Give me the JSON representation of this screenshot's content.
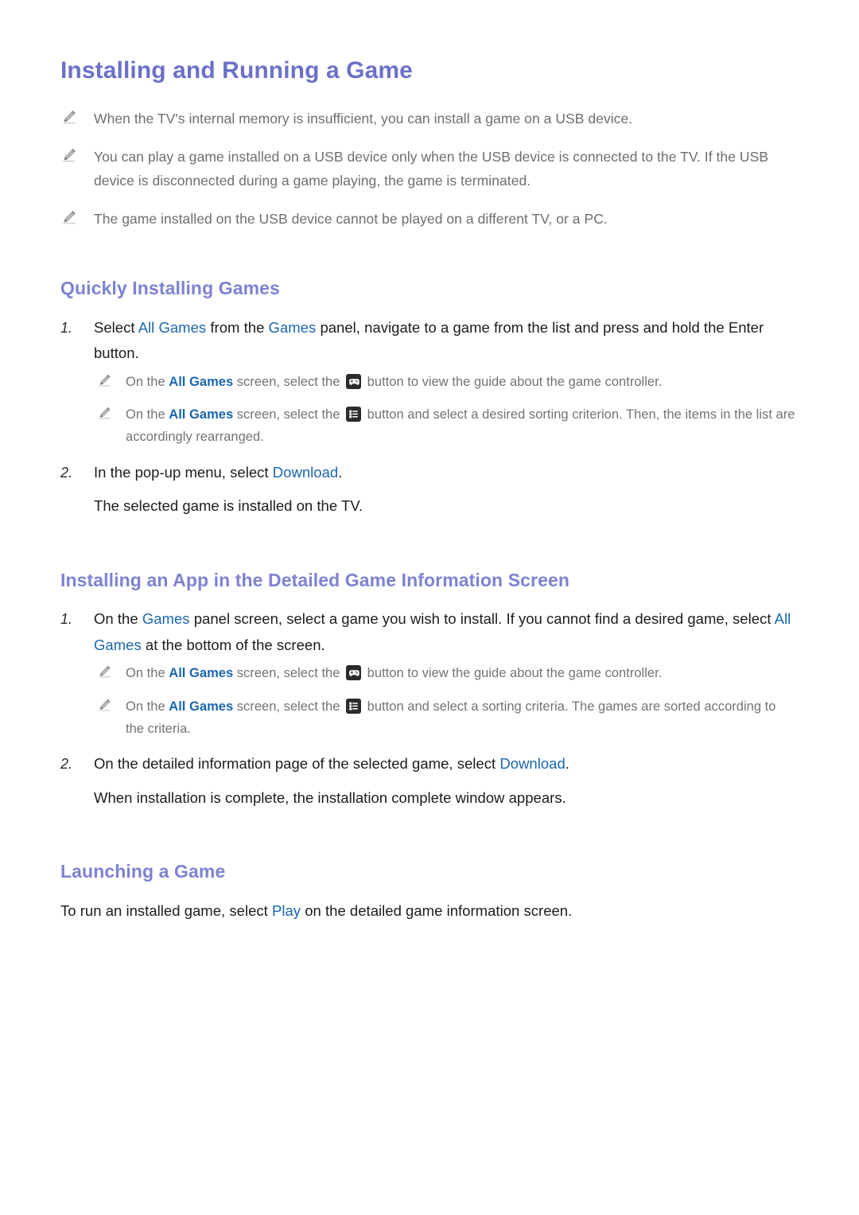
{
  "document": {
    "title": "Installing and Running a Game",
    "intro_notes": [
      "When the TV's internal memory is insufficient, you can install a game on a USB device.",
      "You can play a game installed on a USB device only when the USB device is connected to the TV. If the USB device is disconnected during a game playing, the game is terminated.",
      "The game installed on the USB device cannot be played on a different TV, or a PC."
    ],
    "sections": [
      {
        "heading": "Quickly Installing Games",
        "steps": [
          {
            "number": "1.",
            "parts": [
              {
                "text": "Select ",
                "style": "plain"
              },
              {
                "text": "All Games",
                "style": "link"
              },
              {
                "text": " from the ",
                "style": "plain"
              },
              {
                "text": "Games",
                "style": "link"
              },
              {
                "text": " panel, navigate to a game from the list and press and hold the Enter button.",
                "style": "plain"
              }
            ],
            "subnotes": [
              {
                "parts": [
                  {
                    "text": "On the ",
                    "style": "plain"
                  },
                  {
                    "text": "All Games",
                    "style": "link-bold"
                  },
                  {
                    "text": " screen, select the ",
                    "style": "plain"
                  },
                  {
                    "icon": "gamepad-icon"
                  },
                  {
                    "text": " button to view the guide about the game controller.",
                    "style": "plain"
                  }
                ]
              },
              {
                "parts": [
                  {
                    "text": "On the ",
                    "style": "plain"
                  },
                  {
                    "text": "All Games",
                    "style": "link-bold"
                  },
                  {
                    "text": " screen, select the ",
                    "style": "plain"
                  },
                  {
                    "icon": "sort-list-icon"
                  },
                  {
                    "text": " button and select a desired sorting criterion. Then, the items in the list are accordingly rearranged.",
                    "style": "plain"
                  }
                ]
              }
            ]
          },
          {
            "number": "2.",
            "parts": [
              {
                "text": "In the pop-up menu, select ",
                "style": "plain"
              },
              {
                "text": "Download",
                "style": "link"
              },
              {
                "text": ".",
                "style": "plain"
              }
            ],
            "followup": "The selected game is installed on the TV.",
            "subnotes": []
          }
        ]
      },
      {
        "heading": "Installing an App in the Detailed Game Information Screen",
        "steps": [
          {
            "number": "1.",
            "parts": [
              {
                "text": "On the ",
                "style": "plain"
              },
              {
                "text": "Games",
                "style": "link"
              },
              {
                "text": " panel screen, select a game you wish to install. If you cannot find a desired game, select ",
                "style": "plain"
              },
              {
                "text": "All Games",
                "style": "link"
              },
              {
                "text": " at the bottom of the screen.",
                "style": "plain"
              }
            ],
            "subnotes": [
              {
                "parts": [
                  {
                    "text": "On the ",
                    "style": "plain"
                  },
                  {
                    "text": "All Games",
                    "style": "link-bold"
                  },
                  {
                    "text": " screen, select the ",
                    "style": "plain"
                  },
                  {
                    "icon": "gamepad-icon"
                  },
                  {
                    "text": " button to view the guide about the game controller.",
                    "style": "plain"
                  }
                ]
              },
              {
                "parts": [
                  {
                    "text": "On the ",
                    "style": "plain"
                  },
                  {
                    "text": "All Games",
                    "style": "link-bold"
                  },
                  {
                    "text": " screen, select the ",
                    "style": "plain"
                  },
                  {
                    "icon": "sort-list-icon"
                  },
                  {
                    "text": " button and select a sorting criteria. The games are sorted according to the criteria.",
                    "style": "plain"
                  }
                ]
              }
            ]
          },
          {
            "number": "2.",
            "parts": [
              {
                "text": "On the detailed information page of the selected game, select ",
                "style": "plain"
              },
              {
                "text": "Download",
                "style": "link"
              },
              {
                "text": ".",
                "style": "plain"
              }
            ],
            "followup": "When installation is complete, the installation complete window appears.",
            "subnotes": []
          }
        ]
      },
      {
        "heading": "Launching a Game",
        "steps": [],
        "paragraph_parts": [
          {
            "text": "To run an installed game, select ",
            "style": "plain"
          },
          {
            "text": "Play",
            "style": "link"
          },
          {
            "text": " on the detailed game information screen.",
            "style": "plain"
          }
        ]
      }
    ]
  },
  "colors": {
    "title": "#6b70c8",
    "section_heading": "#7d82d2",
    "link": "#1a66b0",
    "body_text": "#1c1c1c",
    "note_text": "#6e6e6e",
    "icon_bg": "#2b2b2b",
    "page_bg": "#ffffff"
  }
}
